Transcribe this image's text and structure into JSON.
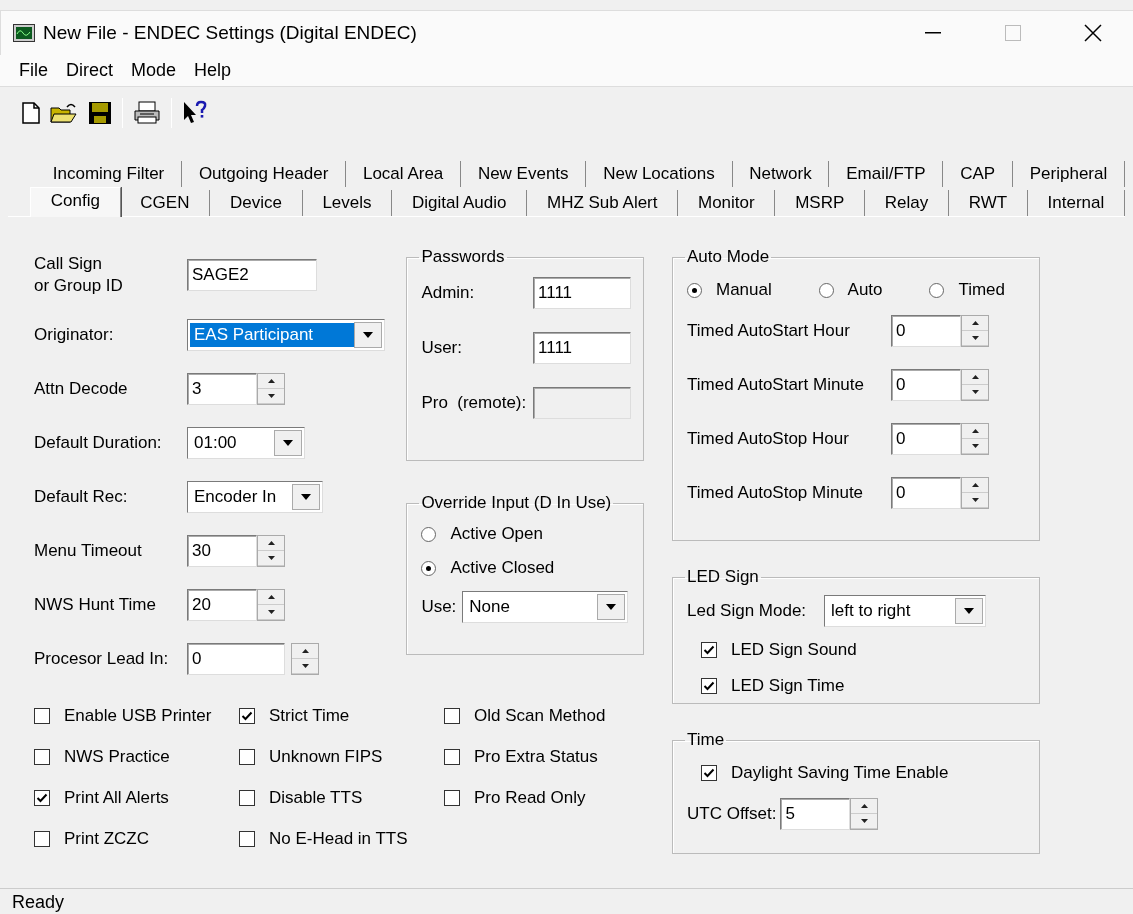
{
  "window": {
    "title": "New File - ENDEC Settings (Digital ENDEC)",
    "maximize_disabled": true
  },
  "menu": [
    "File",
    "Direct",
    "Mode",
    "Help"
  ],
  "tab_rows": [
    {
      "tabs": [
        {
          "label": "Incoming Filter",
          "selected": false
        },
        {
          "label": "Outgoing Header",
          "selected": false
        },
        {
          "label": "Local Area",
          "selected": false
        },
        {
          "label": "New Events",
          "selected": false
        },
        {
          "label": "New Locations",
          "selected": false
        },
        {
          "label": "Network",
          "selected": false
        },
        {
          "label": "Email/FTP",
          "selected": false
        },
        {
          "label": "CAP",
          "selected": false
        },
        {
          "label": "Peripheral",
          "selected": false
        }
      ]
    },
    {
      "tabs": [
        {
          "label": "Config",
          "selected": true
        },
        {
          "label": "CGEN",
          "selected": false
        },
        {
          "label": "Device",
          "selected": false
        },
        {
          "label": "Levels",
          "selected": false
        },
        {
          "label": "Digital Audio",
          "selected": false
        },
        {
          "label": "MHZ Sub Alert",
          "selected": false
        },
        {
          "label": "Monitor",
          "selected": false
        },
        {
          "label": "MSRP",
          "selected": false
        },
        {
          "label": "Relay",
          "selected": false
        },
        {
          "label": "RWT",
          "selected": false
        },
        {
          "label": "Internal",
          "selected": false
        }
      ]
    }
  ],
  "fields": [
    {
      "kind": "text",
      "label": "Call Sign\nor Group ID",
      "value": "SAGE2",
      "focused": false
    },
    {
      "kind": "dropdown",
      "label": "Originator:",
      "value": "EAS Participant",
      "focused": true
    },
    {
      "kind": "spinner",
      "label": "Attn Decode",
      "value": "3",
      "focused": false
    },
    {
      "kind": "dropdown",
      "label": "Default Duration:",
      "value": "01:00",
      "focused": false
    },
    {
      "kind": "dropdown",
      "label": "Default Rec:",
      "value": "Encoder In",
      "focused": false
    },
    {
      "kind": "spinner",
      "label": "Menu Timeout",
      "value": "30",
      "focused": false
    },
    {
      "kind": "spinner",
      "label": "NWS Hunt Time",
      "value": "20",
      "focused": false
    },
    {
      "kind": "spinner",
      "label": "Procesor Lead In:",
      "value": "0",
      "focused": false
    }
  ],
  "checkbox_columns": [
    [
      {
        "label": "Enable USB Printer",
        "checked": false
      },
      {
        "label": "NWS Practice",
        "checked": false
      },
      {
        "label": "Print All Alerts",
        "checked": true
      },
      {
        "label": "Print ZCZC",
        "checked": false
      }
    ],
    [
      {
        "label": "Strict Time",
        "checked": true
      },
      {
        "label": "Unknown FIPS",
        "checked": false
      },
      {
        "label": "Disable TTS",
        "checked": false
      },
      {
        "label": "No E-Head in TTS",
        "checked": false
      }
    ],
    [
      {
        "label": "Old Scan Method",
        "checked": false
      },
      {
        "label": "Pro Extra Status",
        "checked": false
      },
      {
        "label": "Pro Read Only",
        "checked": false
      }
    ]
  ],
  "passwords": {
    "title": "Passwords",
    "fields": [
      {
        "label": "Admin:",
        "value": "1111",
        "disabled": false
      },
      {
        "label": "User:",
        "value": "1111",
        "disabled": false
      },
      {
        "label": "Pro  (remote):",
        "disabled": true
      }
    ]
  },
  "override_input": {
    "title": "Override Input (D In Use)",
    "options": [
      {
        "label": "Active Open",
        "selected": false
      },
      {
        "label": "Active Closed",
        "selected": true
      }
    ],
    "use_label": "Use:",
    "use_value": "None"
  },
  "auto_mode": {
    "title": "Auto Mode",
    "options": [
      {
        "label": "Manual",
        "selected": true
      },
      {
        "label": "Auto",
        "selected": false
      },
      {
        "label": "Timed",
        "selected": false
      }
    ],
    "spinners": [
      {
        "label": "Timed AutoStart Hour",
        "value": "0"
      },
      {
        "label": "Timed AutoStart Minute",
        "value": "0"
      },
      {
        "label": "Timed AutoStop Hour",
        "value": "0"
      },
      {
        "label": "Timed AutoStop Minute",
        "value": "0"
      }
    ]
  },
  "led_sign": {
    "title": "LED Sign",
    "mode_label": "Led Sign Mode:",
    "mode_value": "left to right",
    "checkboxes": [
      {
        "label": "LED Sign Sound",
        "checked": true
      },
      {
        "label": "LED Sign Time",
        "checked": true
      }
    ]
  },
  "time": {
    "title": "Time",
    "checkbox": {
      "label": "Daylight Saving Time Enable",
      "checked": true
    },
    "offset_label": "UTC Offset:",
    "offset_value": "5"
  },
  "status_bar": "Ready"
}
